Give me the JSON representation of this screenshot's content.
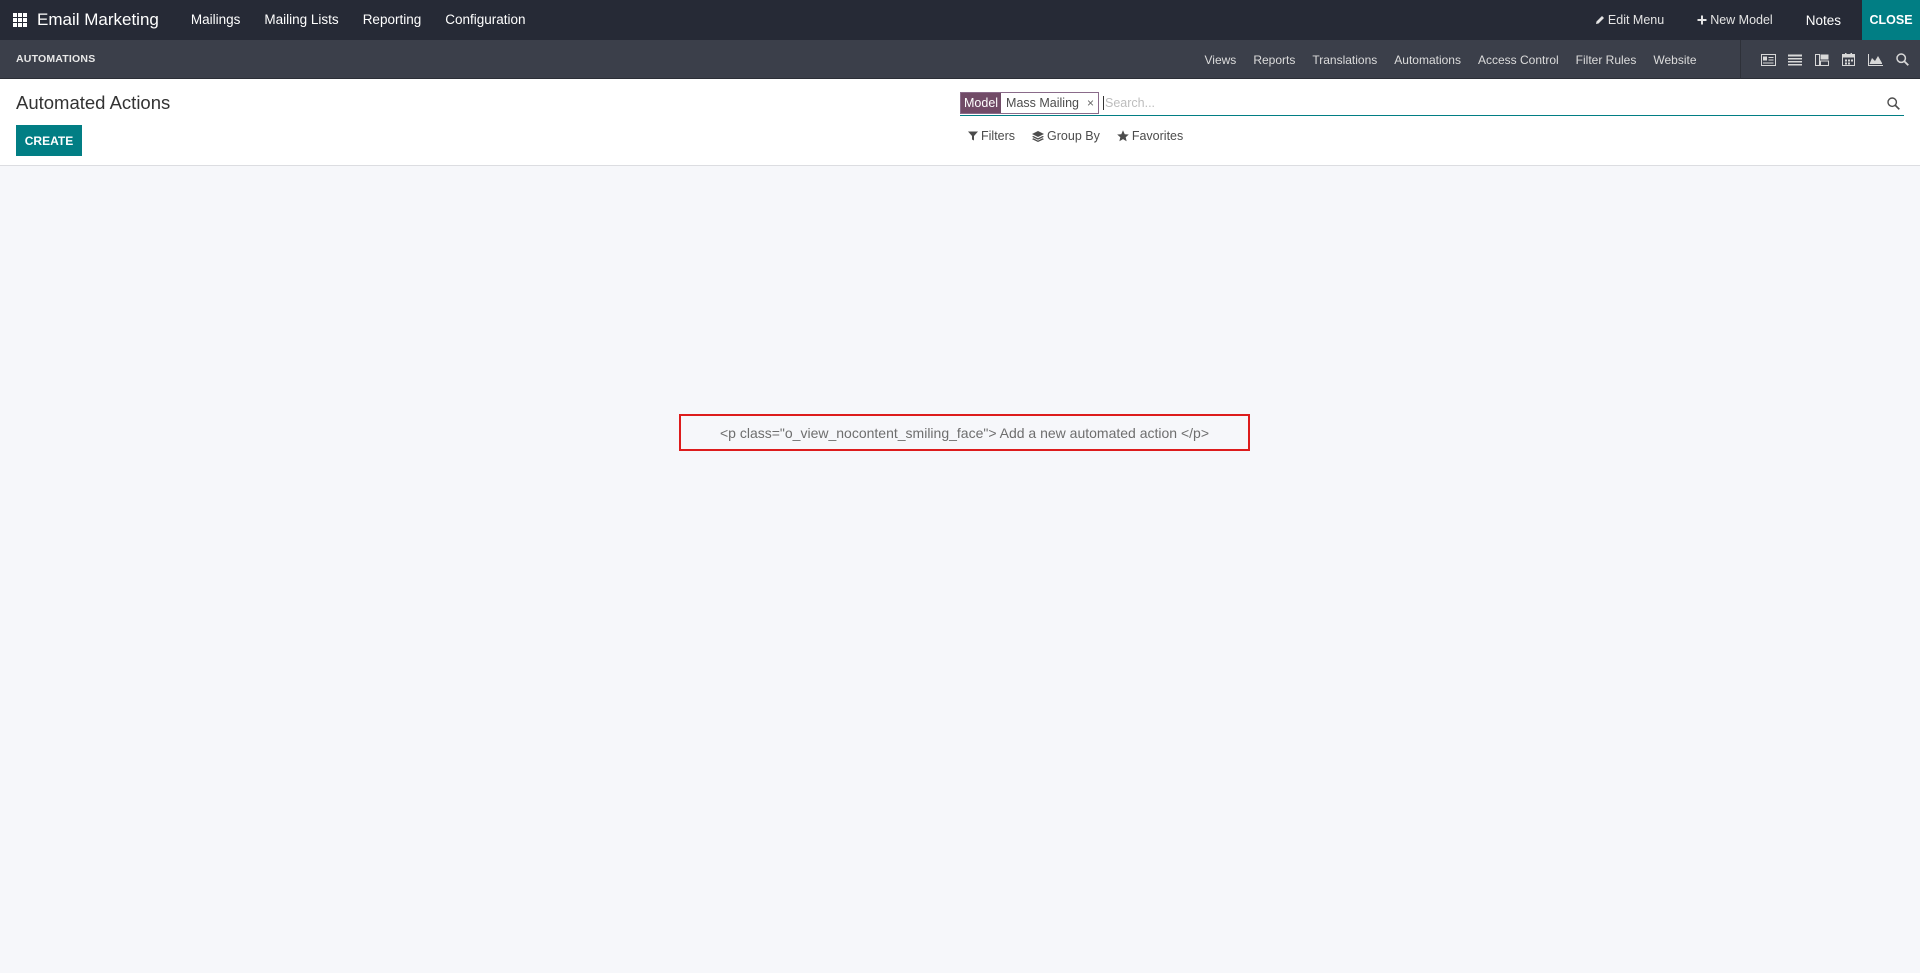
{
  "topbar": {
    "app_title": "Email Marketing",
    "menu": [
      "Mailings",
      "Mailing Lists",
      "Reporting",
      "Configuration"
    ],
    "edit_menu": "Edit Menu",
    "new_model": "New Model",
    "notes": "Notes",
    "close": "CLOSE"
  },
  "studio_bar": {
    "title": "AUTOMATIONS",
    "menu": [
      "Views",
      "Reports",
      "Translations",
      "Automations",
      "Access Control",
      "Filter Rules",
      "Website"
    ],
    "view_icons": [
      "form-view-icon",
      "list-view-icon",
      "kanban-view-icon",
      "calendar-view-icon",
      "graph-view-icon",
      "search-view-icon"
    ]
  },
  "control_panel": {
    "title": "Automated Actions",
    "create_label": "CREATE",
    "search": {
      "facet_label": "Model",
      "facet_value": "Mass Mailing",
      "facet_remove": "×",
      "placeholder": "Search..."
    },
    "filters_label": "Filters",
    "groupby_label": "Group By",
    "favorites_label": "Favorites"
  },
  "nocontent": {
    "text": "<p class=\"o_view_nocontent_smiling_face\"> Add a new automated action </p>"
  },
  "colors": {
    "navbar": "#262a36",
    "studio_bar": "#3b3f4a",
    "accent": "#017e84",
    "facet": "#714b67",
    "highlight": "#dd1c1c"
  }
}
